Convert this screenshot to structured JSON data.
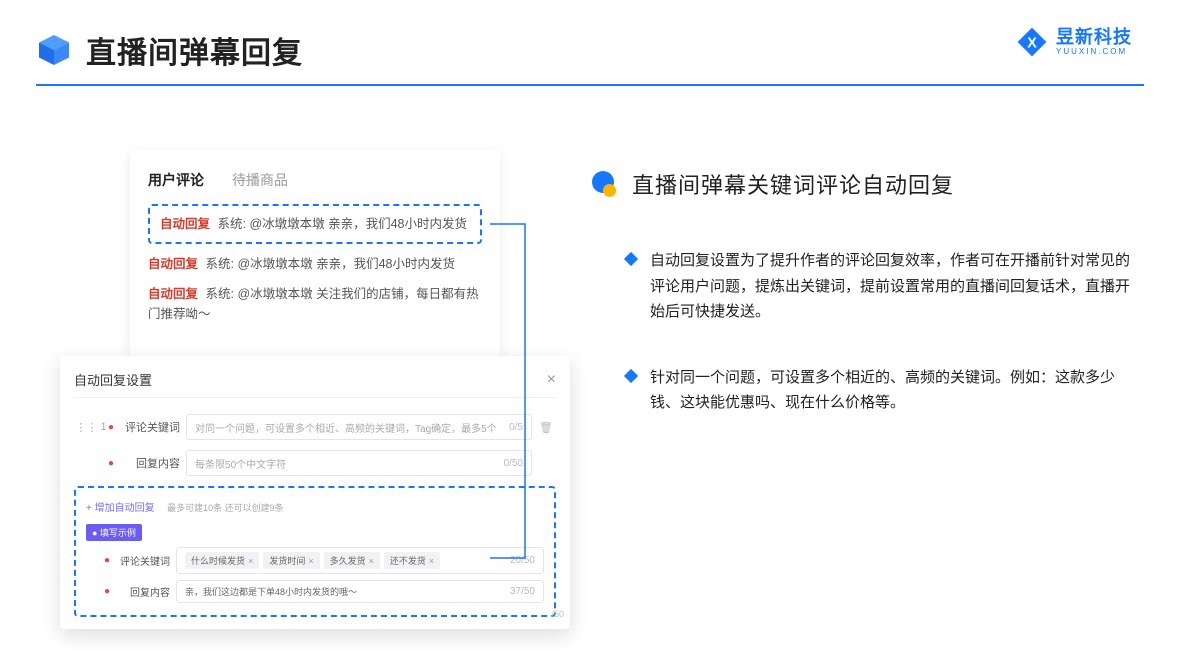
{
  "header": {
    "title": "直播间弹幕回复",
    "brand_name": "昱新科技",
    "brand_domain": "YUUXIN.COM"
  },
  "comments": {
    "tab_a": "用户评论",
    "tab_b": "待播商品",
    "row1_tag": "自动回复",
    "row1_body": "系统: @冰墩墩本墩 亲亲，我们48小时内发货",
    "row2_tag": "自动回复",
    "row2_body": "系统: @冰墩墩本墩 亲亲，我们48小时内发货",
    "row3_tag": "自动回复",
    "row3_body": "系统: @冰墩墩本墩 关注我们的店铺，每日都有热门推荐呦～"
  },
  "settings": {
    "title": "自动回复设置",
    "close": "×",
    "row_index": "1",
    "label_keyword": "评论关键词",
    "placeholder_keyword": "对同一个问题，可设置多个相近、高频的关键词，Tag确定，最多5个",
    "counter_keyword": "0/5",
    "label_content": "回复内容",
    "placeholder_content": "每条限50个中文字符",
    "counter_content": "0/50",
    "add_link": "+ 增加自动回复",
    "add_hint": "最多可建10条 还可以创建9条",
    "example_badge": "● 填写示例",
    "ex_label_kw": "评论关键词",
    "ex_chip1": "什么时候发货",
    "ex_chip2": "发货时间",
    "ex_chip3": "多久发货",
    "ex_chip4": "还不发货",
    "ex_counter_kw": "20/50",
    "ex_label_content": "回复内容",
    "ex_content": "亲，我们这边都是下单48小时内发货的哦～",
    "ex_counter_content": "37/50",
    "scroll_stub": "/50"
  },
  "right": {
    "section_title": "直播间弹幕关键词评论自动回复",
    "bullet1": "自动回复设置为了提升作者的评论回复效率，作者可在开播前针对常见的评论用户问题，提炼出关键词，提前设置常用的直播间回复话术，直播开始后可快捷发送。",
    "bullet2": "针对同一个问题，可设置多个相近的、高频的关键词。例如：这款多少钱、这块能优惠吗、现在什么价格等。"
  }
}
